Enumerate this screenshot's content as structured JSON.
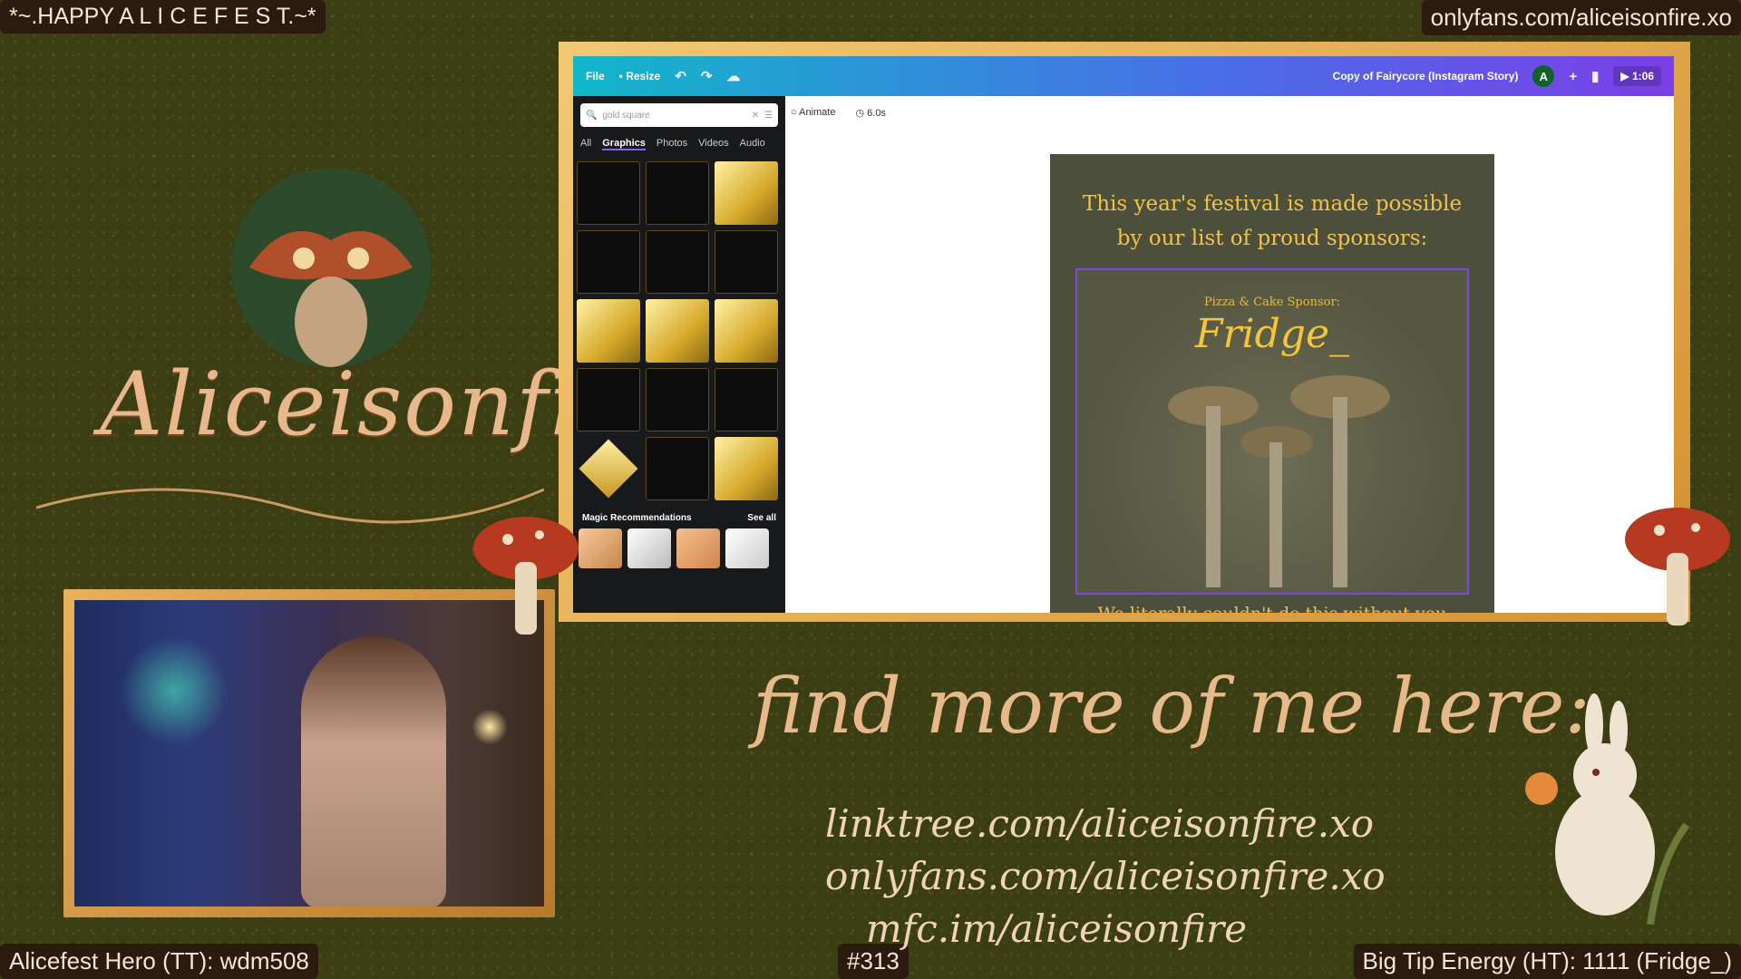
{
  "overlay": {
    "top_left": "*~.HAPPY A L I C E F E S T.~*",
    "top_right": "onlyfans.com/aliceisonfire.xo",
    "bottom_left": "Alicefest Hero (TT): wdm508",
    "bottom_center": "#313",
    "bottom_right": "Big Tip Energy (HT): 1111 (Fridge_)"
  },
  "branding": {
    "logo": "Aliceisonfire"
  },
  "canva": {
    "menu_file": "File",
    "menu_resize": "• Resize",
    "doc_title": "Copy of Fairycore (Instagram Story)",
    "avatar_letter": "A",
    "play_label": "▶ 1:06",
    "toolbar": {
      "animate": "Animate",
      "duration": "6.0s"
    },
    "search": {
      "value": "gold square"
    },
    "tabs": [
      "All",
      "Graphics",
      "Photos",
      "Videos",
      "Audio"
    ],
    "active_tab": "Graphics",
    "magic_title": "Magic Recommendations",
    "see_all": "See all"
  },
  "design": {
    "heading": "This year's festival is made possible by our list of proud sponsors:",
    "sponsor_label": "Pizza & Cake Sponsor:",
    "sponsor_name": "Fridge_",
    "footer": "We literally couldn't do this without you"
  },
  "promo": {
    "headline": "find more of me here:",
    "links": [
      "linktree.com/aliceisonfire.xo",
      "onlyfans.com/aliceisonfire.xo",
      "mfc.im/aliceisonfire"
    ]
  }
}
